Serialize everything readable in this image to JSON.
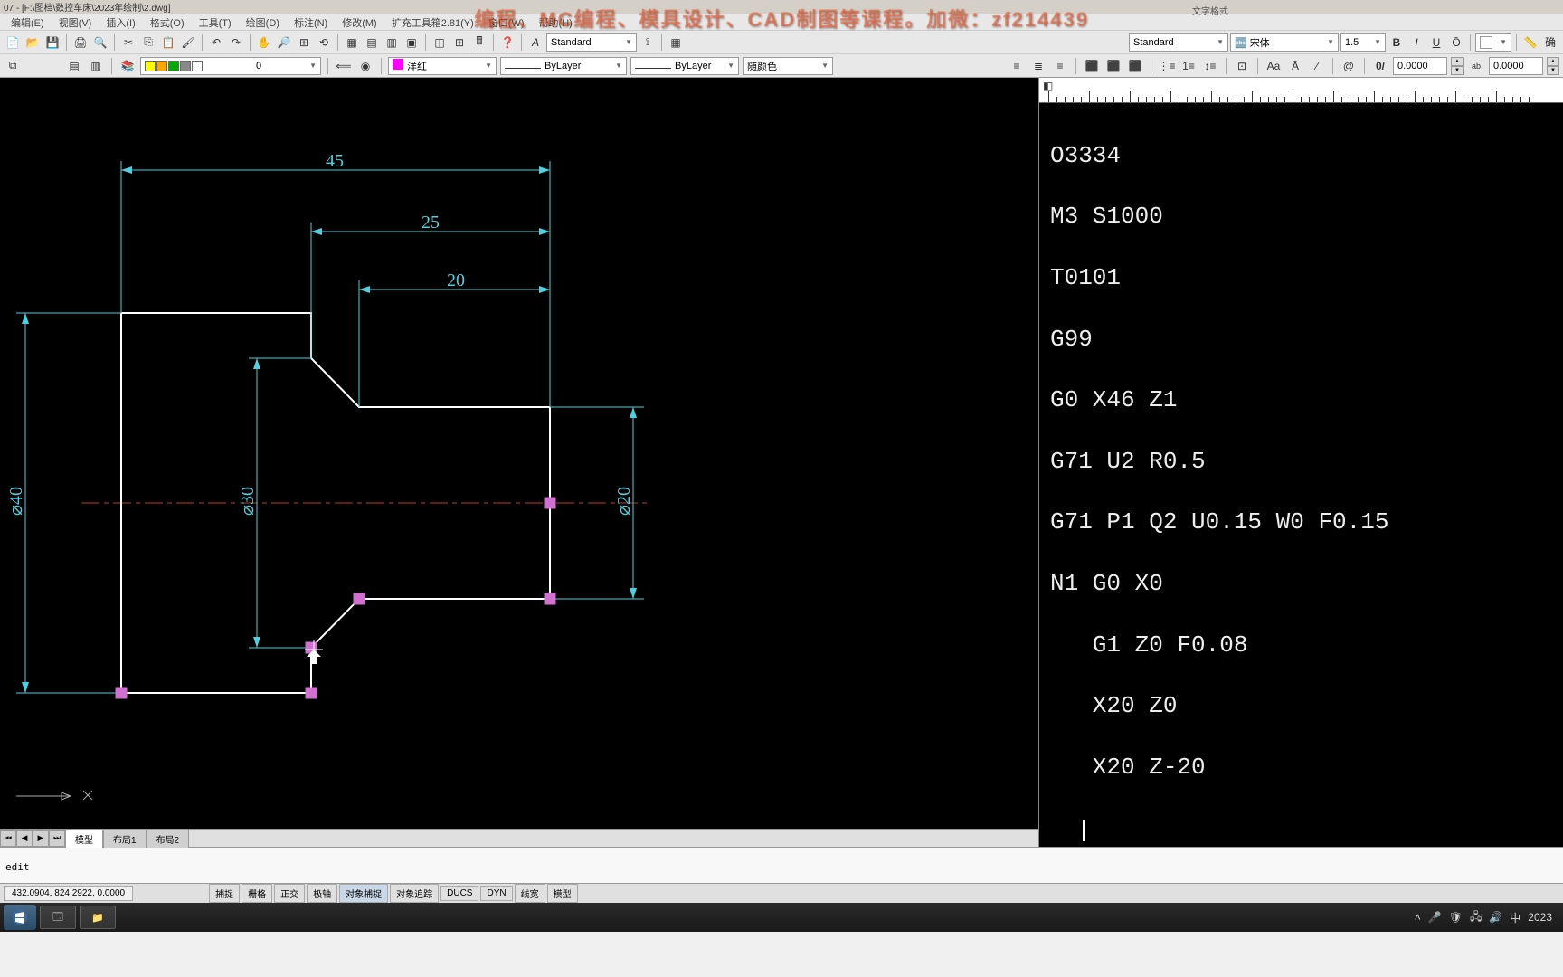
{
  "title": {
    "path": "07 - [F:\\图档\\数控车床\\2023年绘制\\2.dwg]"
  },
  "watermark": "编程、MC编程、模具设计、CAD制图等课程。加微：zf214439",
  "text_format_label": "文字格式",
  "menu": [
    "编辑(E)",
    "视图(V)",
    "插入(I)",
    "格式(O)",
    "工具(T)",
    "绘图(D)",
    "标注(N)",
    "修改(M)",
    "扩充工具箱2.81(Y)",
    "窗口(W)",
    "帮助(H)"
  ],
  "toolbar": {
    "style1": "Standard",
    "style_dropdown": "Standard",
    "font_dropdown": "宋体",
    "size_dropdown": "1.5",
    "bold": "B",
    "italic": "I",
    "underline": "U",
    "overline": "Ō",
    "byLayer_sample": "▬",
    "dim_value": "0.0000",
    "ab_label": "ab",
    "confirm": "确",
    "layer_label": "0"
  },
  "toolbar2": {
    "layer_name": "洋红",
    "linetype1": "ByLayer",
    "linetype2": "ByLayer",
    "color_mode": "随颜色"
  },
  "drawing": {
    "dims": {
      "d45": "45",
      "d25": "25",
      "d20": "20",
      "dia40": "⌀40",
      "dia30": "⌀30",
      "dia20": "⌀20"
    }
  },
  "gcode": [
    "O3334",
    "M3 S1000",
    "T0101",
    "G99",
    "G0 X46 Z1",
    "G71 U2 R0.5",
    "G71 P1 Q2 U0.15 W0 F0.15",
    "N1 G0 X0",
    "   G1 Z0 F0.08",
    "   X20 Z0",
    "   X20 Z-20"
  ],
  "tabs": {
    "model": "模型",
    "layout1": "布局1",
    "layout2": "布局2"
  },
  "command": {
    "last": "edit"
  },
  "status": {
    "coords": "432.0904, 824.2922, 0.0000",
    "buttons": [
      "捕捉",
      "栅格",
      "正交",
      "极轴",
      "对象捕捉",
      "对象追踪",
      "DUCS",
      "DYN",
      "线宽",
      "模型"
    ]
  },
  "tray": {
    "ime": "中",
    "year": "2023"
  },
  "chart_data": {
    "type": "diagram",
    "note": "CNC lathe profile drawing with dimensions",
    "dimensions_mm": {
      "length_total": 45,
      "length_step1": 25,
      "length_step2": 20,
      "dia_large": 40,
      "dia_mid": 30,
      "dia_small": 20
    }
  }
}
